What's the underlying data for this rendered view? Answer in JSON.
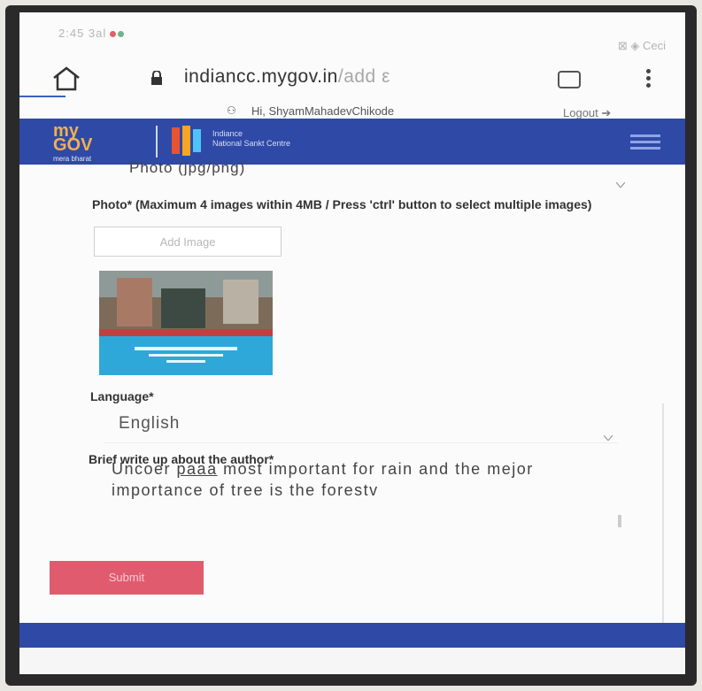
{
  "status_bar": {
    "time_signal": "2:45  3al",
    "right_icons": "⊠ ◈ Ceci"
  },
  "browser": {
    "url_host": "indiancc.mygov.in",
    "url_path": "/add",
    "url_suffix": " ε"
  },
  "user": {
    "greeting": "Hi, ShyamMahadevChikode",
    "logout": "Logout ➔"
  },
  "site": {
    "logo_text": "my\nGOV",
    "logo_tag": "mera bharat",
    "sub_logo": "Indiance\nNational Sankt Centre"
  },
  "form": {
    "photo_field": "Photo (jpg/png)",
    "photo_instructions": "Photo* (Maximum 4 images within 4MB / Press 'ctrl' button to select multiple images)",
    "add_image": "Add Image",
    "language_label": "Language*",
    "language_value": "English",
    "about_label": "Brief write up about the author*",
    "about_text_pre": "Uncoer ",
    "about_text_link": "paaa",
    "about_text_post": " most important for rain and the mejor importance of tree is the forestv",
    "submit_label": "Submit"
  },
  "colors": {
    "brand_blue": "#2f49a7",
    "submit_pink": "#e15b6e"
  }
}
